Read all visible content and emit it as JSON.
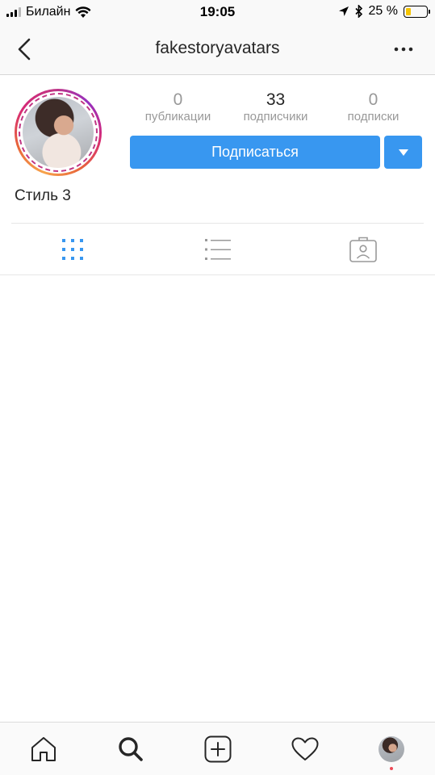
{
  "status_bar": {
    "carrier": "Билайн",
    "time": "19:05",
    "battery_percent": "25 %",
    "battery_level": 0.25
  },
  "nav": {
    "username": "fakestoryavatars",
    "back_icon": "chevron-left-icon",
    "more_icon": "more-horizontal-icon"
  },
  "profile": {
    "stats": [
      {
        "value": "0",
        "label": "публикации"
      },
      {
        "value": "33",
        "label": "подписчики"
      },
      {
        "value": "0",
        "label": "подписки"
      }
    ],
    "follow_label": "Подписаться",
    "name": "Стиль 3"
  },
  "tabs": [
    {
      "icon": "grid-icon",
      "active": true
    },
    {
      "icon": "list-icon",
      "active": false
    },
    {
      "icon": "tagged-icon",
      "active": false
    }
  ],
  "bottom_bar": [
    {
      "icon": "home-icon"
    },
    {
      "icon": "search-icon"
    },
    {
      "icon": "add-post-icon"
    },
    {
      "icon": "heart-icon"
    },
    {
      "icon": "profile-avatar"
    }
  ],
  "colors": {
    "accent": "#3897f0",
    "active_tab": "#3897f0",
    "inactive_icon": "#999999",
    "notification_dot": "#ed4956"
  }
}
